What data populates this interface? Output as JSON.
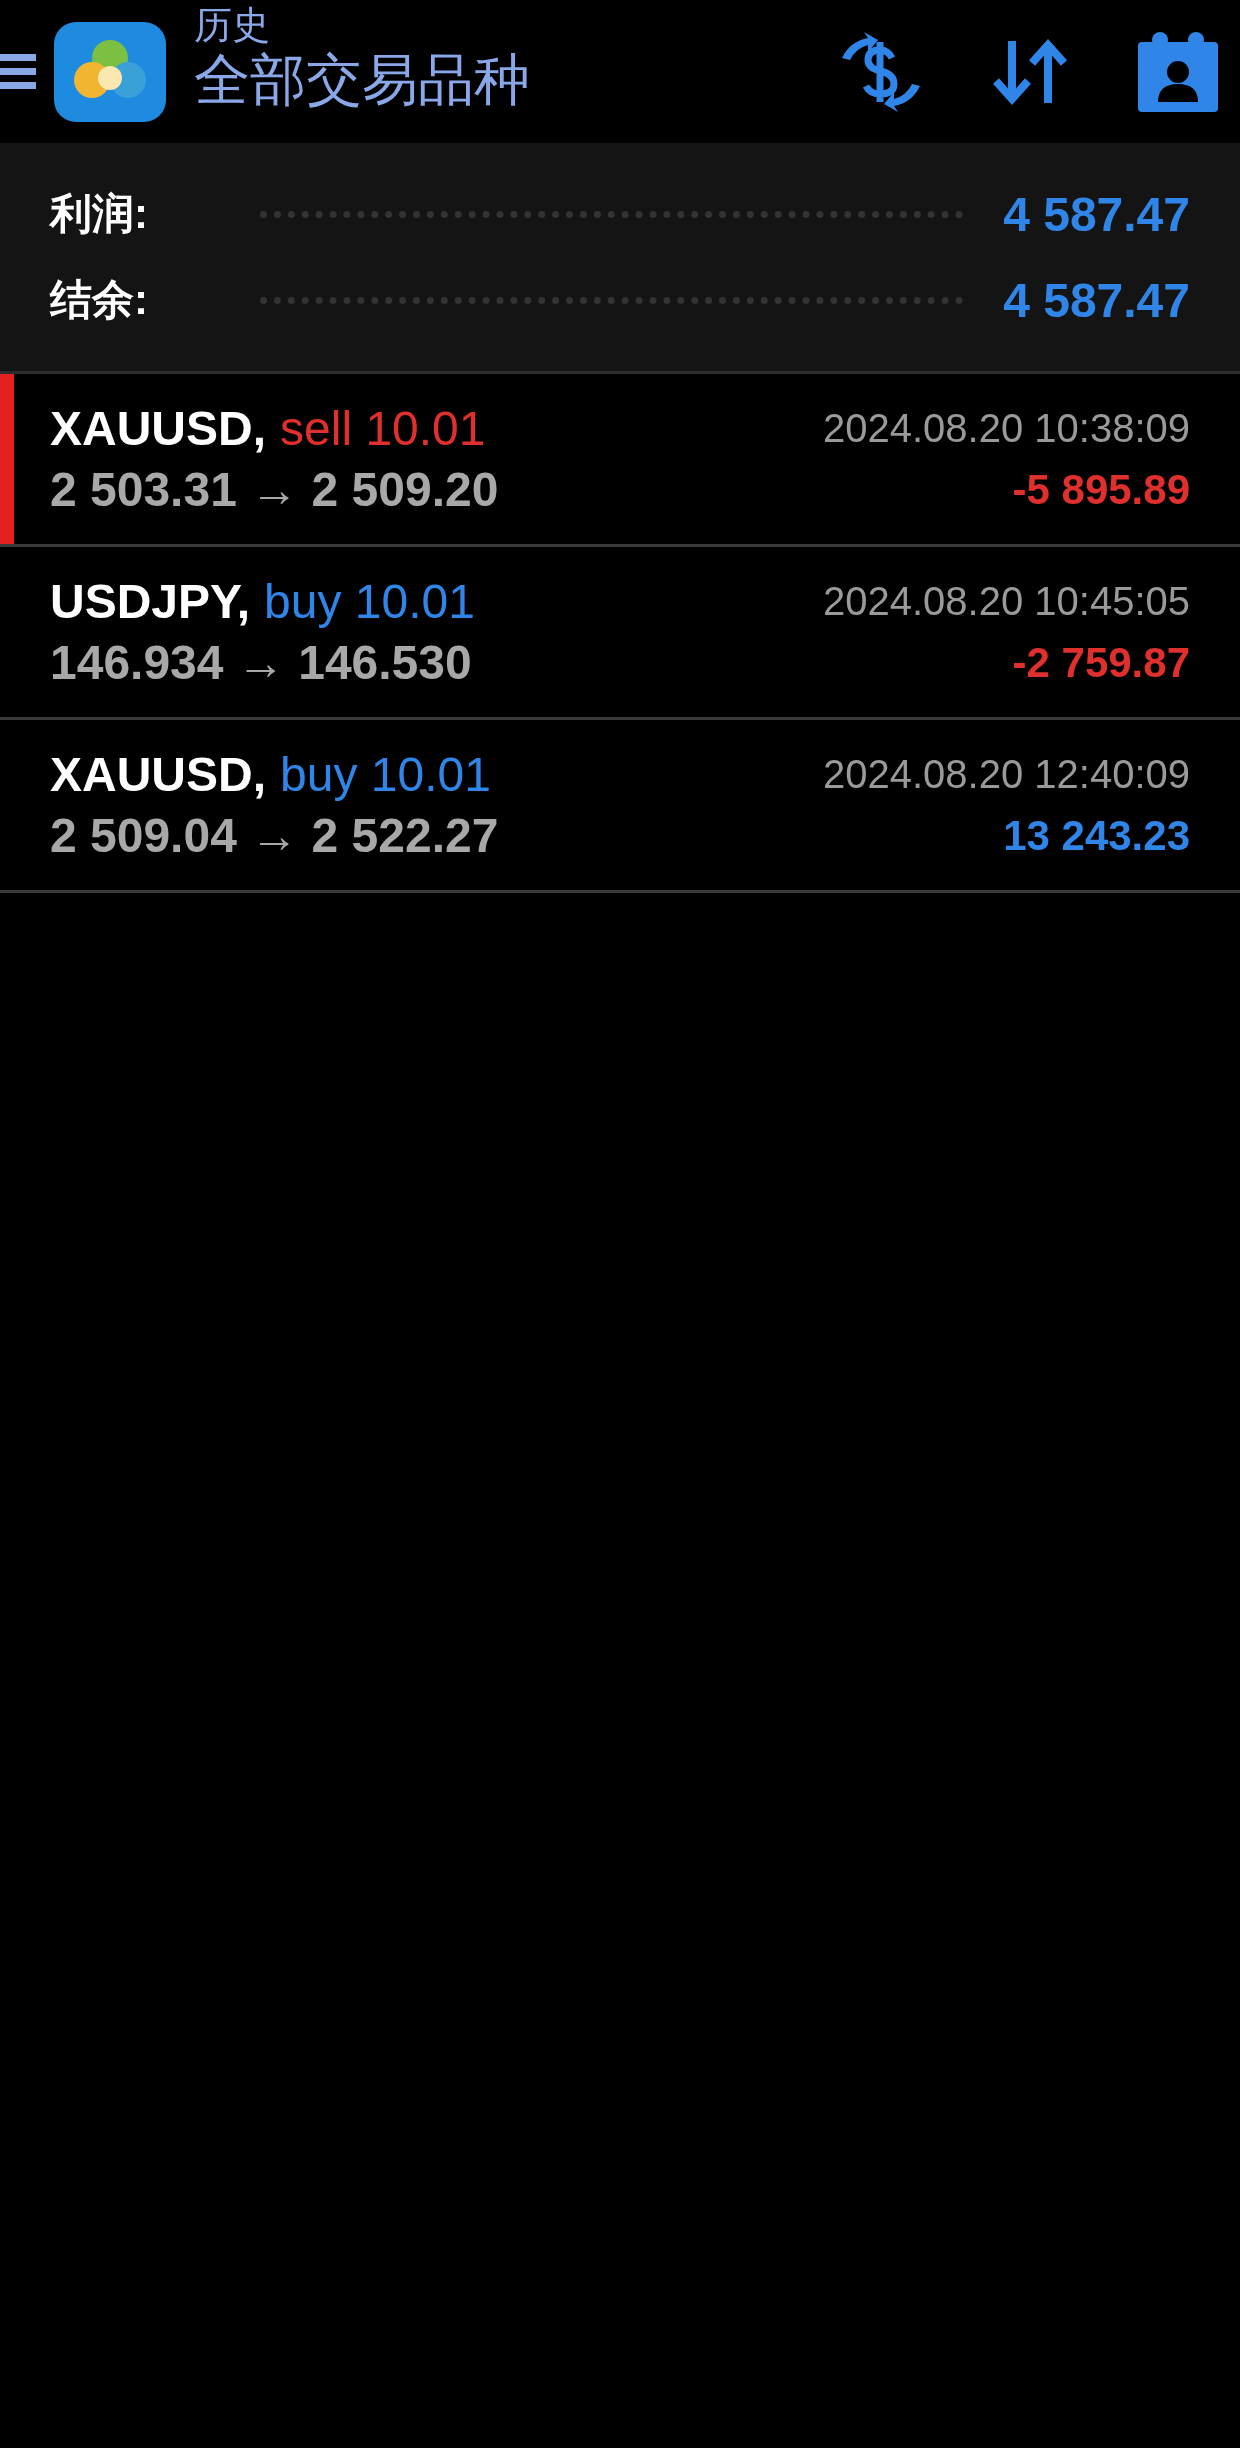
{
  "header": {
    "subtitle": "历史",
    "title": "全部交易品种"
  },
  "summary": [
    {
      "label": "利润:",
      "value": "4 587.47"
    },
    {
      "label": "结余:",
      "value": "4 587.47"
    }
  ],
  "trades": [
    {
      "symbol": "XAUUSD,",
      "volume": {
        "text": "sell 10.01",
        "color": "#e0302e"
      },
      "prices": "2 503.31 → 2 509.20",
      "time": "2024.08.20 10:38:09",
      "profit": {
        "text": "-5 895.89",
        "color": "#e0302e"
      },
      "selected": true
    },
    {
      "symbol": "USDJPY,",
      "volume": {
        "text": "buy 10.01",
        "color": "#2f86e8"
      },
      "prices": "146.934 → 146.530",
      "time": "2024.08.20 10:45:05",
      "profit": {
        "text": "-2 759.87",
        "color": "#e0302e"
      },
      "selected": false
    },
    {
      "symbol": "XAUUSD,",
      "volume": {
        "text": "buy 10.01",
        "color": "#2f86e8"
      },
      "prices": "2 509.04 → 2 522.27",
      "time": "2024.08.20 12:40:09",
      "profit": {
        "text": "13 243.23",
        "color": "#2f86e8"
      },
      "selected": false
    }
  ]
}
